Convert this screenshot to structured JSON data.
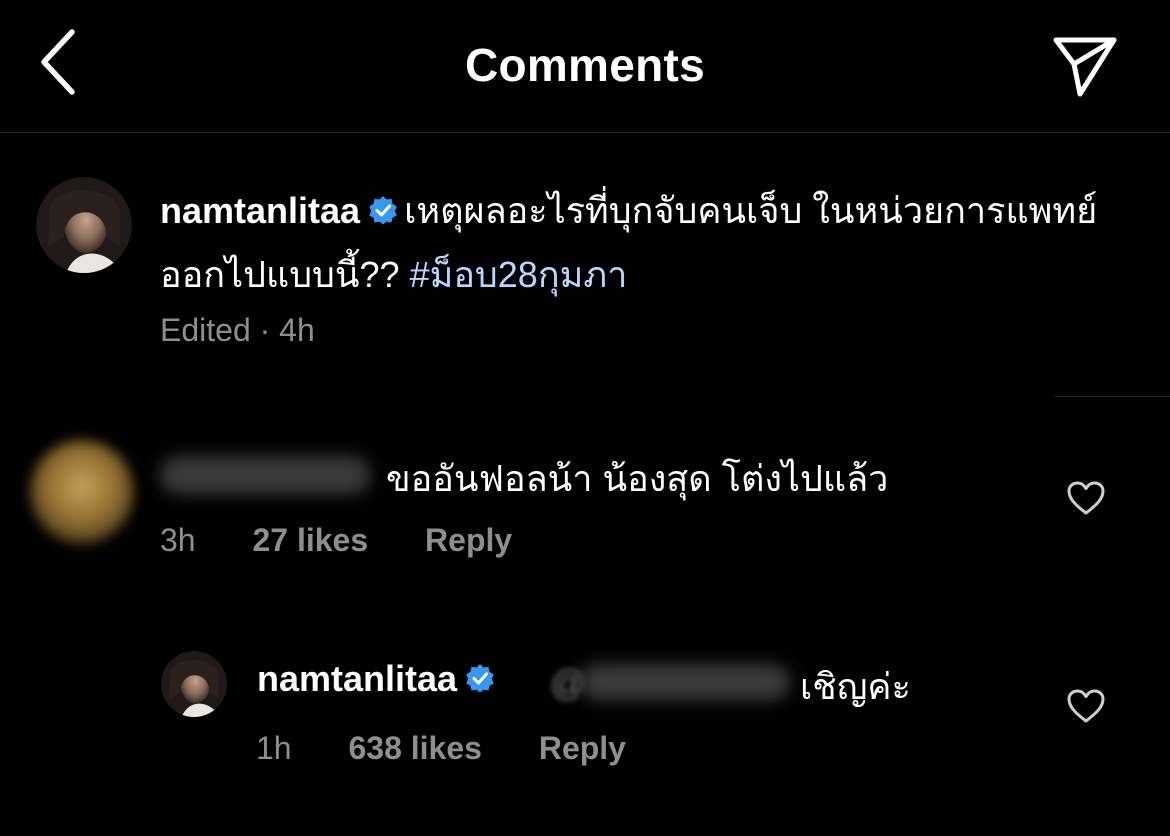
{
  "header": {
    "title": "Comments",
    "back_icon": "chevron-left-icon",
    "share_icon": "send-icon"
  },
  "caption": {
    "username": "namtanlitaa",
    "text": "เหตุผลอะไรที่บุกจับคนเจ็บ ในหน่วยการแพทย์ออกไปแบบนี้?? ",
    "hashtag": "#ม็อบ28กุมภา",
    "edited": "Edited",
    "separator": "·",
    "time": "4h"
  },
  "comment1": {
    "text": "ขออันฟอลน้า น้องสุด โต่งไปแล้ว",
    "time": "3h",
    "likes": "27 likes",
    "reply": "Reply",
    "like_icon": "heart-icon"
  },
  "reply1": {
    "username": "namtanlitaa",
    "mention_prefix": "@",
    "text": "เชิญค่ะ",
    "time": "1h",
    "likes": "638 likes",
    "reply": "Reply",
    "like_icon": "heart-icon"
  },
  "colors": {
    "background": "#000000",
    "text": "#ffffff",
    "meta": "#8e8e8e",
    "hashtag": "#b8d6ff",
    "verified": "#3897f0",
    "divider": "#262626"
  }
}
